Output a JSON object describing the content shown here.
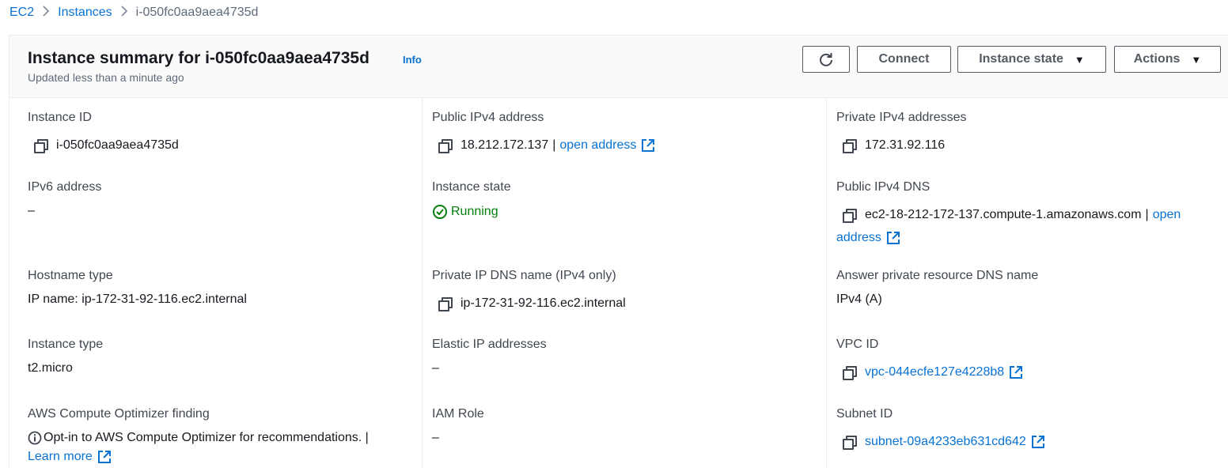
{
  "breadcrumb": {
    "root": "EC2",
    "section": "Instances",
    "current": "i-050fc0aa9aea4735d"
  },
  "header": {
    "title": "Instance summary for i-050fc0aa9aea4735d",
    "info": "Info",
    "subtitle": "Updated less than a minute ago",
    "connect": "Connect",
    "instance_state": "Instance state",
    "actions": "Actions"
  },
  "col1": {
    "instance_id_label": "Instance ID",
    "instance_id": "i-050fc0aa9aea4735d",
    "ipv6_label": "IPv6 address",
    "ipv6": "–",
    "hostname_type_label": "Hostname type",
    "hostname_type": "IP name: ip-172-31-92-116.ec2.internal",
    "instance_type_label": "Instance type",
    "instance_type": "t2.micro",
    "optimizer_label": "AWS Compute Optimizer finding",
    "optimizer_text": "Opt-in to AWS Compute Optimizer for recommendations. |",
    "learn_more": "Learn more"
  },
  "col2": {
    "public_ipv4_label": "Public IPv4 address",
    "public_ipv4": "18.212.172.137",
    "sep": "|",
    "open_address": "open address",
    "instance_state_label": "Instance state",
    "instance_state": "Running",
    "private_dns_label": "Private IP DNS name (IPv4 only)",
    "private_dns": "ip-172-31-92-116.ec2.internal",
    "elastic_ip_label": "Elastic IP addresses",
    "elastic_ip": "–",
    "iam_role_label": "IAM Role",
    "iam_role": "–"
  },
  "col3": {
    "private_ipv4_label": "Private IPv4 addresses",
    "private_ipv4": "172.31.92.116",
    "public_dns_label": "Public IPv4 DNS",
    "public_dns": "ec2-18-212-172-137.compute-1.amazonaws.com",
    "sep": "|",
    "open_1": "open",
    "open_2": "address",
    "answer_dns_label": "Answer private resource DNS name",
    "answer_dns": "IPv4 (A)",
    "vpc_label": "VPC ID",
    "vpc": "vpc-044ecfe127e4228b8",
    "subnet_label": "Subnet ID",
    "subnet": "subnet-09a4233eb631cd642"
  },
  "colors": {
    "link": "#0972d3",
    "running": "#037f0c",
    "text": "#16191f"
  },
  "icons": [
    "refresh-icon",
    "caret-down-icon",
    "copy-icon",
    "external-link-icon",
    "check-circle-icon",
    "info-circle-icon"
  ]
}
